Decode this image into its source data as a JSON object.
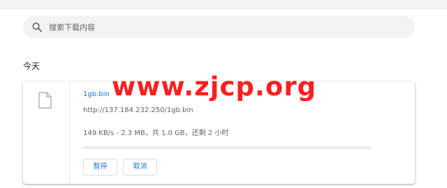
{
  "search": {
    "placeholder": "搜索下载内容",
    "icon": "search-icon"
  },
  "date_group": {
    "label": "今天"
  },
  "download": {
    "file_icon": "file-icon",
    "file_name": "1gb.bin",
    "url": "http://137.184.232.250/1gb.bin",
    "status": "149 KB/s - 2.3 MB，共 1.0 GB，还剩 2 小时",
    "progress_fraction": 0,
    "pause_label": "暂停",
    "cancel_label": "取消"
  },
  "watermark": {
    "text": "www.zjcp.org"
  },
  "colors": {
    "accent": "#1a73e8",
    "watermark": "#ff1f1f",
    "search_bg": "#f1f3f4"
  }
}
